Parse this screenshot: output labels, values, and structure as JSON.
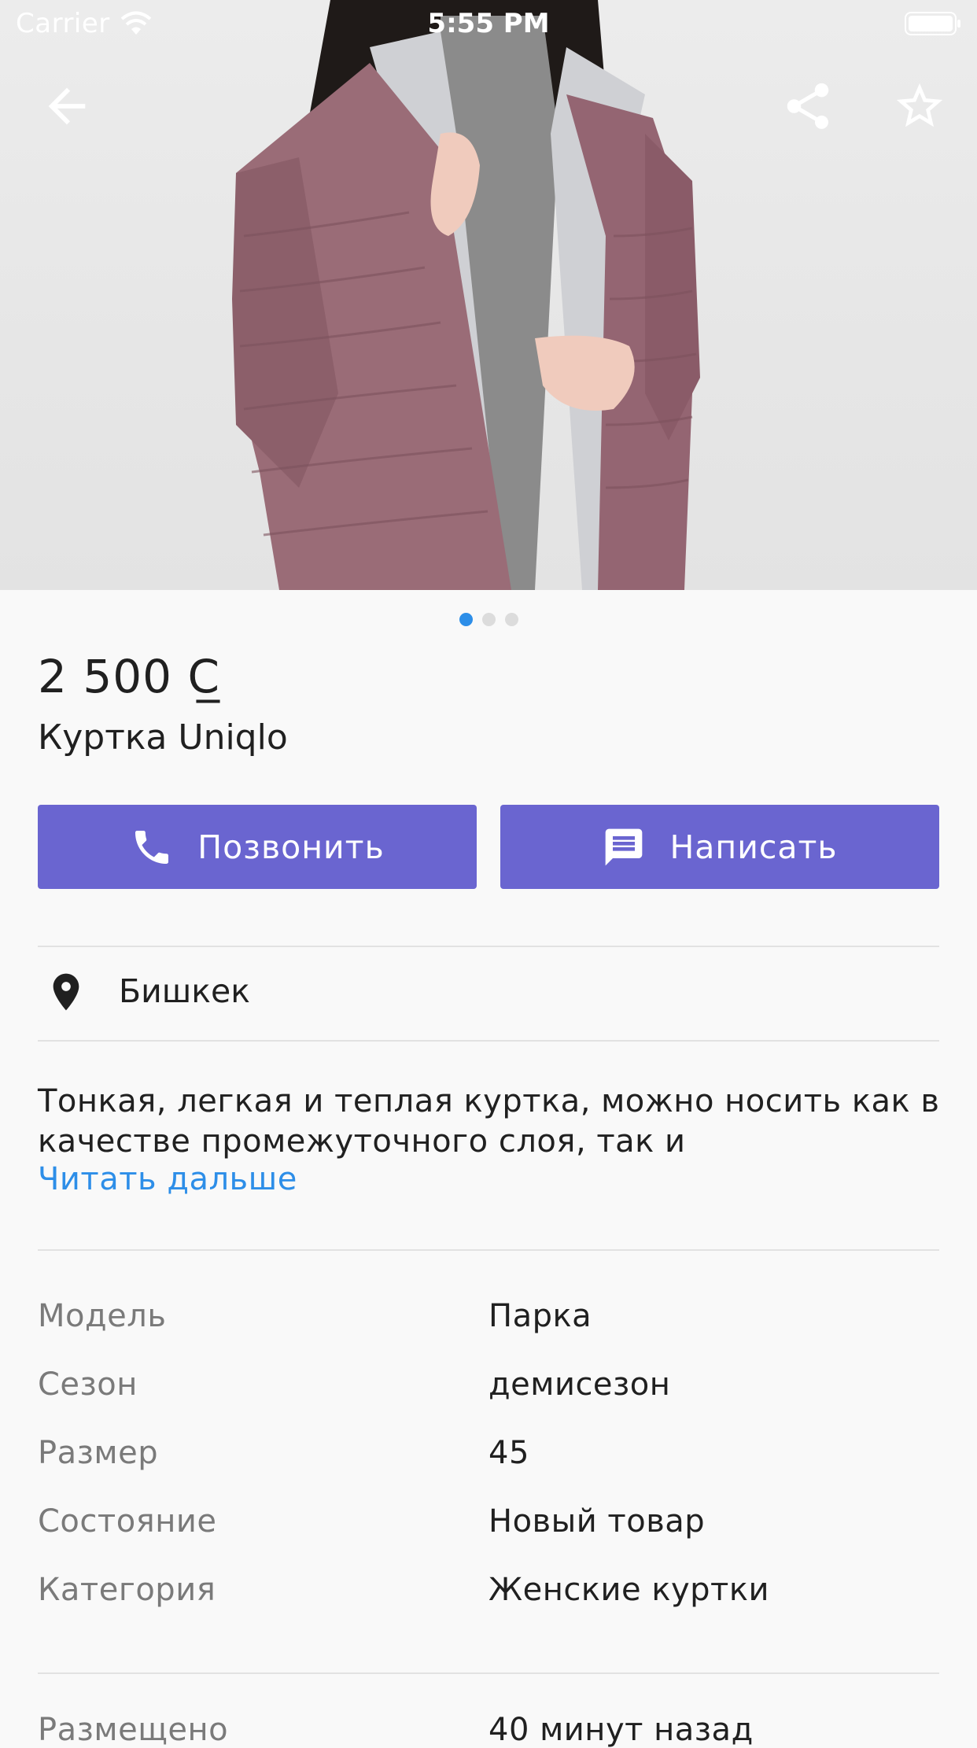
{
  "status_bar": {
    "carrier": "Carrier",
    "time": "5:55 PM"
  },
  "top_bar": {
    "back_icon": "arrow-left-icon",
    "share_icon": "share-icon",
    "favorite_icon": "star-outline-icon"
  },
  "gallery": {
    "photo": "woman-in-mauve-puffer-jacket",
    "page_count": 3,
    "active_page": 1
  },
  "product": {
    "price": "2 500 С̲",
    "title": "Куртка Uniqlo"
  },
  "actions": {
    "call_label": "Позвонить",
    "write_label": "Написать",
    "call_icon": "phone-icon",
    "write_icon": "message-icon"
  },
  "location": {
    "icon": "map-pin-icon",
    "city": "Бишкек"
  },
  "description": {
    "text_line1": "Тонкая, легкая и теплая куртка, можно носить как в",
    "text_line2": "качестве промежуточного слоя, так и",
    "read_more": "Читать дальше"
  },
  "specs": [
    {
      "key": "Модель",
      "value": "Парка"
    },
    {
      "key": "Сезон",
      "value": "демисезон"
    },
    {
      "key": "Размер",
      "value": "45"
    },
    {
      "key": "Состояние",
      "value": "Новый товар"
    },
    {
      "key": "Категория",
      "value": "Женские куртки"
    }
  ],
  "posted": {
    "key": "Размещено",
    "value": "40 минут назад"
  },
  "colors": {
    "accent": "#6a65d0",
    "link": "#2d8ee8",
    "jacket": "#9a6c77"
  }
}
